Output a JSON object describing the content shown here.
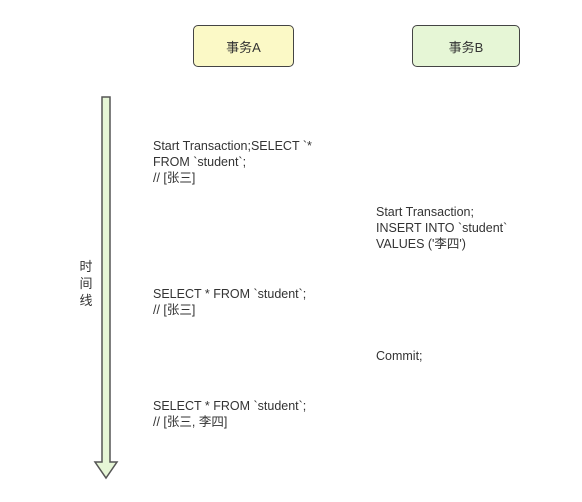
{
  "transactions": {
    "a": {
      "label": "事务A",
      "color": "#fbf9c6"
    },
    "b": {
      "label": "事务B",
      "color": "#e6f6d6"
    }
  },
  "timeline": {
    "label_chars": [
      "时",
      "间",
      "线"
    ],
    "arrow_fill": "#e6f6d6",
    "arrow_stroke": "#555555"
  },
  "steps": {
    "a1": {
      "lines": [
        "Start Transaction;SELECT `*",
        "FROM `student`;",
        "// [张三]"
      ]
    },
    "b1": {
      "lines": [
        "Start Transaction;",
        "INSERT INTO `student`",
        "VALUES ('李四')"
      ]
    },
    "a2": {
      "lines": [
        "SELECT * FROM `student`;",
        "// [张三]"
      ]
    },
    "b2": {
      "lines": [
        "Commit;"
      ]
    },
    "a3": {
      "lines": [
        "SELECT * FROM `student`;",
        "// [张三, 李四]"
      ]
    }
  }
}
